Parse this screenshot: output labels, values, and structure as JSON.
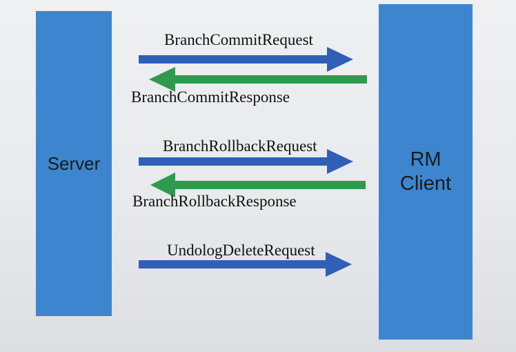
{
  "participants": {
    "server": "Server",
    "client_line1": "RM",
    "client_line2": "Client"
  },
  "messages": [
    {
      "label": "BranchCommitRequest",
      "direction": "right",
      "color": "#2f5fb6"
    },
    {
      "label": "BranchCommitResponse",
      "direction": "left",
      "color": "#2e9a4e"
    },
    {
      "label": "BranchRollbackRequest",
      "direction": "right",
      "color": "#2f5fb6"
    },
    {
      "label": "BranchRollbackResponse",
      "direction": "left",
      "color": "#2e9a4e"
    },
    {
      "label": "UndologDeleteRequest",
      "direction": "right",
      "color": "#2f5fb6"
    }
  ]
}
